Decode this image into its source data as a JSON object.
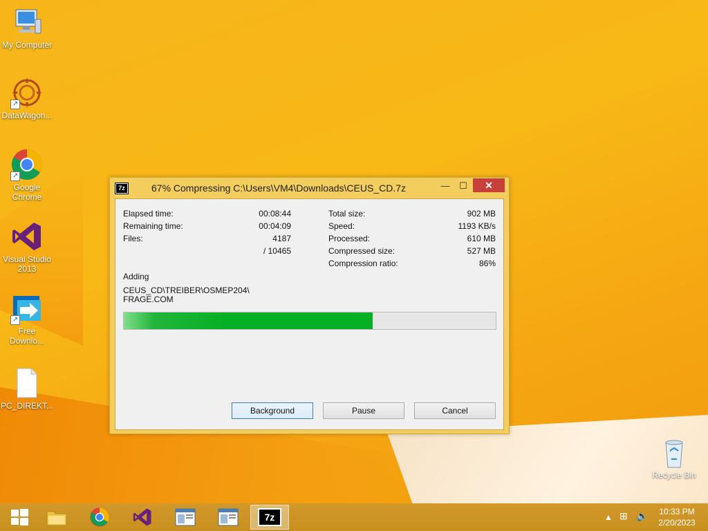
{
  "desktop": {
    "icons": [
      {
        "label": "My Computer"
      },
      {
        "label": "DataWagon..."
      },
      {
        "label": "Google Chrome"
      },
      {
        "label": "Visual Studio 2013"
      },
      {
        "label": "Free Downlo..."
      },
      {
        "label": "PC_DIREKT..."
      },
      {
        "label": "Recycle Bin"
      }
    ]
  },
  "dialog": {
    "title": "67% Compressing C:\\Users\\VM4\\Downloads\\CEUS_CD.7z",
    "app_icon_text": "7z",
    "stats_left": [
      {
        "label": "Elapsed time:",
        "value": "00:08:44"
      },
      {
        "label": "Remaining time:",
        "value": "00:04:09"
      },
      {
        "label": "Files:",
        "value": "4187"
      }
    ],
    "files_total": "/ 10465",
    "stats_right": [
      {
        "label": "Total size:",
        "value": "902 MB"
      },
      {
        "label": "Speed:",
        "value": "1193 KB/s"
      },
      {
        "label": "Processed:",
        "value": "610 MB"
      },
      {
        "label": "Compressed size:",
        "value": "527 MB"
      },
      {
        "label": "Compression ratio:",
        "value": "86%"
      }
    ],
    "action_label": "Adding",
    "current_file_line1": "CEUS_CD\\TREIBER\\OSMEP204\\",
    "current_file_line2": "FRAGE.COM",
    "progress_percent": 67,
    "buttons": {
      "background": "Background",
      "pause": "Pause",
      "cancel": "Cancel"
    }
  },
  "taskbar": {
    "clock_time": "10:33 PM",
    "clock_date": "2/20/2023",
    "active_app_text": "7z"
  },
  "colors": {
    "progress": "#06b025",
    "close": "#c7403a"
  }
}
